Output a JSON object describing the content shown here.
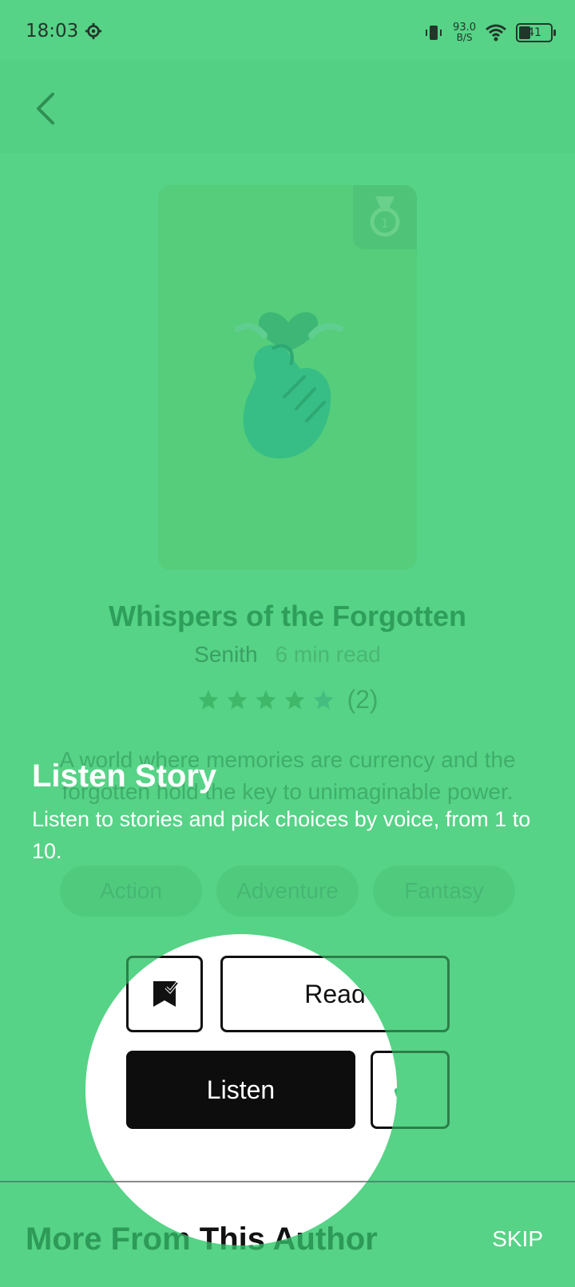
{
  "status_bar": {
    "time": "18:03",
    "net_speed_value": "93.0",
    "net_speed_unit": "B/S",
    "battery": "41"
  },
  "story": {
    "title": "Whispers of the Forgotten",
    "author": "Senith",
    "read_time": "6 min read",
    "rating_stars": 5,
    "rating_count": "(2)",
    "description": "A world where memories are currency and the forgotten hold the key to unimaginable power.",
    "tags": [
      "Action",
      "Adventure",
      "Fantasy"
    ]
  },
  "actions": {
    "read_label": "Read",
    "listen_label": "Listen"
  },
  "tooltip": {
    "title": "Listen Story",
    "description": "Listen to stories and pick choices by voice, from 1 to 10.",
    "skip_label": "SKIP"
  },
  "sections": {
    "more_from_author": "More From This Author"
  },
  "colors": {
    "overlay": "#56d386",
    "accent": "#2e9e5b",
    "listen_button": "#0d0d0d"
  }
}
